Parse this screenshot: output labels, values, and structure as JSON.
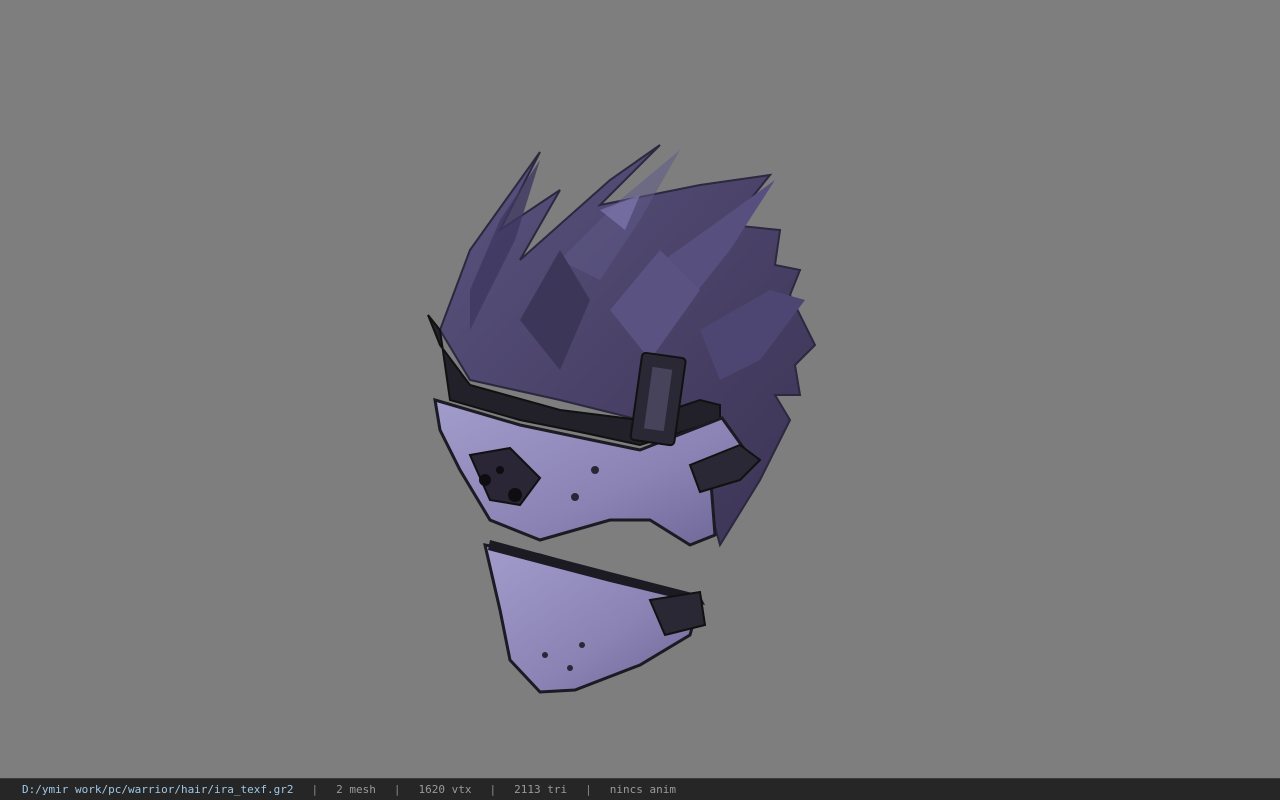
{
  "viewport": {
    "background": "#7e7e7e",
    "model": {
      "hair_color": "#4a4268",
      "mask_color": "#8d86b6",
      "strap_color": "#1c1a22"
    }
  },
  "status_bar": {
    "file_path": "D:/ymir work/pc/warrior/hair/ira_texf.gr2",
    "separator": "|",
    "mesh": "2 mesh",
    "vtx": "1620 vtx",
    "tri": "2113 tri",
    "anim": "nincs anim"
  }
}
